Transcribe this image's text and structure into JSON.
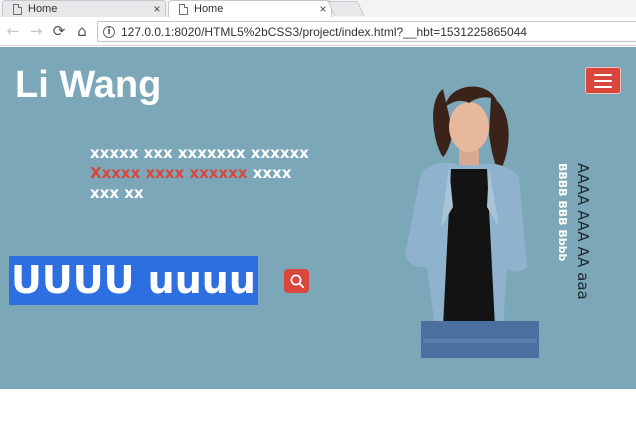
{
  "browser": {
    "tabs": [
      {
        "title": "Home",
        "close": "×"
      },
      {
        "title": "Home",
        "close": "×"
      }
    ],
    "url": "127.0.0.1:8020/HTML5%2bCSS3/project/index.html?__hbt=1531225865044",
    "nav_icons": {
      "back": "←",
      "forward": "→",
      "reload": "⟳",
      "home": "⌂"
    }
  },
  "page": {
    "brand": "Li Wang",
    "intro_line1": "xxxxx xxx xxxxxxx xxxxxx",
    "intro_accent": "Xxxxx xxxx xxxxxx",
    "intro_rest": " xxxx xxx xx",
    "hero_text": "UUUU uuuu",
    "vertical_text_1": "BBBB BBB Bbbb",
    "vertical_text_2": "AAAA AAA AA aaa",
    "colors": {
      "background": "#7ba7b8",
      "accent": "#d9473c",
      "selection": "#2d6fe0"
    }
  }
}
